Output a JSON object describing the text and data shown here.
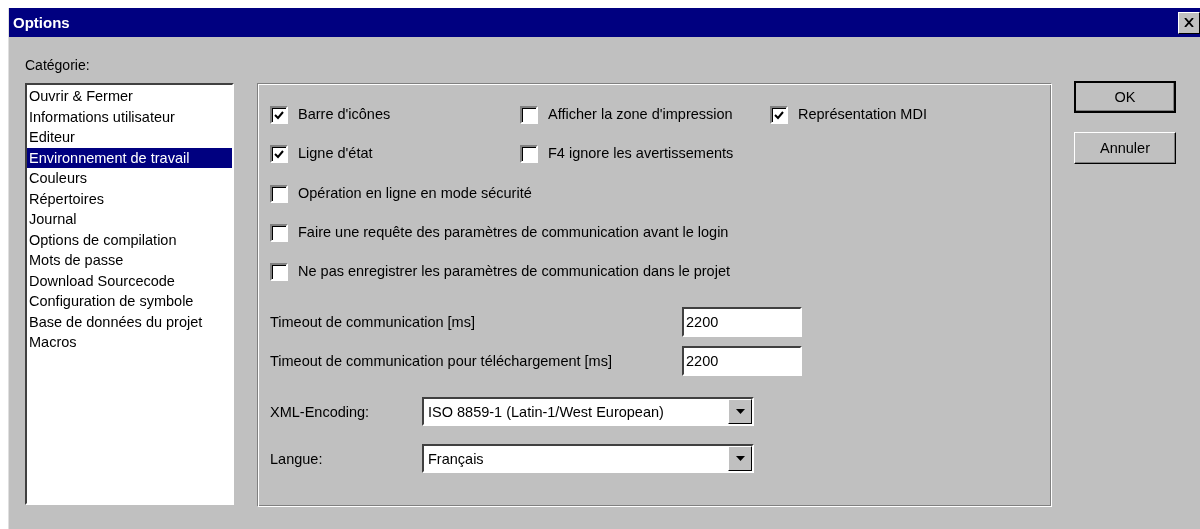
{
  "window": {
    "title": "Options"
  },
  "category": {
    "label": "Catégorie:",
    "items": [
      {
        "label": "Ouvrir & Fermer",
        "selected": false
      },
      {
        "label": "Informations utilisateur",
        "selected": false
      },
      {
        "label": "Editeur",
        "selected": false
      },
      {
        "label": "Environnement de travail",
        "selected": true
      },
      {
        "label": "Couleurs",
        "selected": false
      },
      {
        "label": "Répertoires",
        "selected": false
      },
      {
        "label": "Journal",
        "selected": false
      },
      {
        "label": "Options de compilation",
        "selected": false
      },
      {
        "label": "Mots de passe",
        "selected": false
      },
      {
        "label": "Download Sourcecode",
        "selected": false
      },
      {
        "label": "Configuration de symbole",
        "selected": false
      },
      {
        "label": "Base de données du projet",
        "selected": false
      },
      {
        "label": "Macros",
        "selected": false
      }
    ]
  },
  "checkbox_rows": [
    [
      {
        "label": "Barre d'icônes",
        "checked": true
      },
      {
        "label": "Afficher la zone d'impression",
        "checked": false
      },
      {
        "label": "Représentation MDI",
        "checked": true
      }
    ],
    [
      {
        "label": "Ligne d'état",
        "checked": true
      },
      {
        "label": "F4 ignore les avertissements",
        "checked": false
      }
    ],
    [
      {
        "label": "Opération en ligne en mode sécurité",
        "checked": false
      }
    ],
    [
      {
        "label": "Faire une requête des paramètres de communication avant le login",
        "checked": false
      }
    ],
    [
      {
        "label": "Ne pas enregistrer les paramètres de communication dans le projet",
        "checked": false
      }
    ]
  ],
  "text_fields": [
    {
      "label": "Timeout de communication [ms]",
      "value": "2200"
    },
    {
      "label": "Timeout de communication pour téléchargement [ms]",
      "value": "2200"
    }
  ],
  "dropdowns": [
    {
      "label": "XML-Encoding:",
      "value": "ISO 8859-1 (Latin-1/West European)"
    },
    {
      "label": "Langue:",
      "value": "Français"
    }
  ],
  "buttons": [
    "OK",
    "Annuler"
  ]
}
